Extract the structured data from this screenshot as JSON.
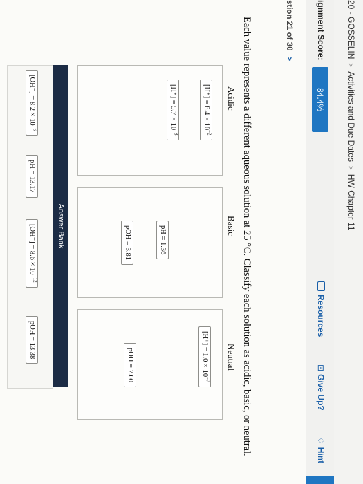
{
  "breadcrumb": {
    "course": "20 - GOSSELIN",
    "sep": ">",
    "activities": "Activities and Due Dates",
    "assignment": "HW Chapter 11"
  },
  "score": {
    "label": "ignment Score:",
    "value": "84.4%"
  },
  "toolbar": {
    "resources": "Resources",
    "give_up": "Give Up?",
    "hint": "Hint"
  },
  "question": {
    "position": "stion 21 of 30",
    "chevron": ">"
  },
  "prompt": "Each value represents a different aqueous solution at 25 °C. Classify each solution as acidic, basic, or neutral.",
  "bins": [
    {
      "heading": "Acidic",
      "tiles": [
        {
          "base": "[H⁺] = 8.4 × 10",
          "exp": "−2"
        },
        {
          "base": "[H⁺] = 5.7 × 10",
          "exp": "−8"
        }
      ]
    },
    {
      "heading": "Basic",
      "tiles": [
        {
          "base": "pH = 1.36",
          "exp": ""
        },
        {
          "base": "pOH = 3.81",
          "exp": ""
        }
      ]
    },
    {
      "heading": "Neutral",
      "tiles": [
        {
          "base": "[H⁺] = 1.0 × 10",
          "exp": "−7"
        },
        {
          "base": "pOH = 7.00",
          "exp": ""
        }
      ]
    }
  ],
  "answer_bank": {
    "label": "Answer Bank",
    "tiles": [
      {
        "base": "[OH⁻] = 8.2 × 10",
        "exp": "−6"
      },
      {
        "base": "pH = 13.17",
        "exp": ""
      },
      {
        "base": "[OH⁻] = 8.6 × 10",
        "exp": "−12"
      },
      {
        "base": "pOH = 13.38",
        "exp": ""
      }
    ]
  },
  "colors": {
    "accent": "#1f76c2",
    "bank_header": "#1c2c45"
  }
}
